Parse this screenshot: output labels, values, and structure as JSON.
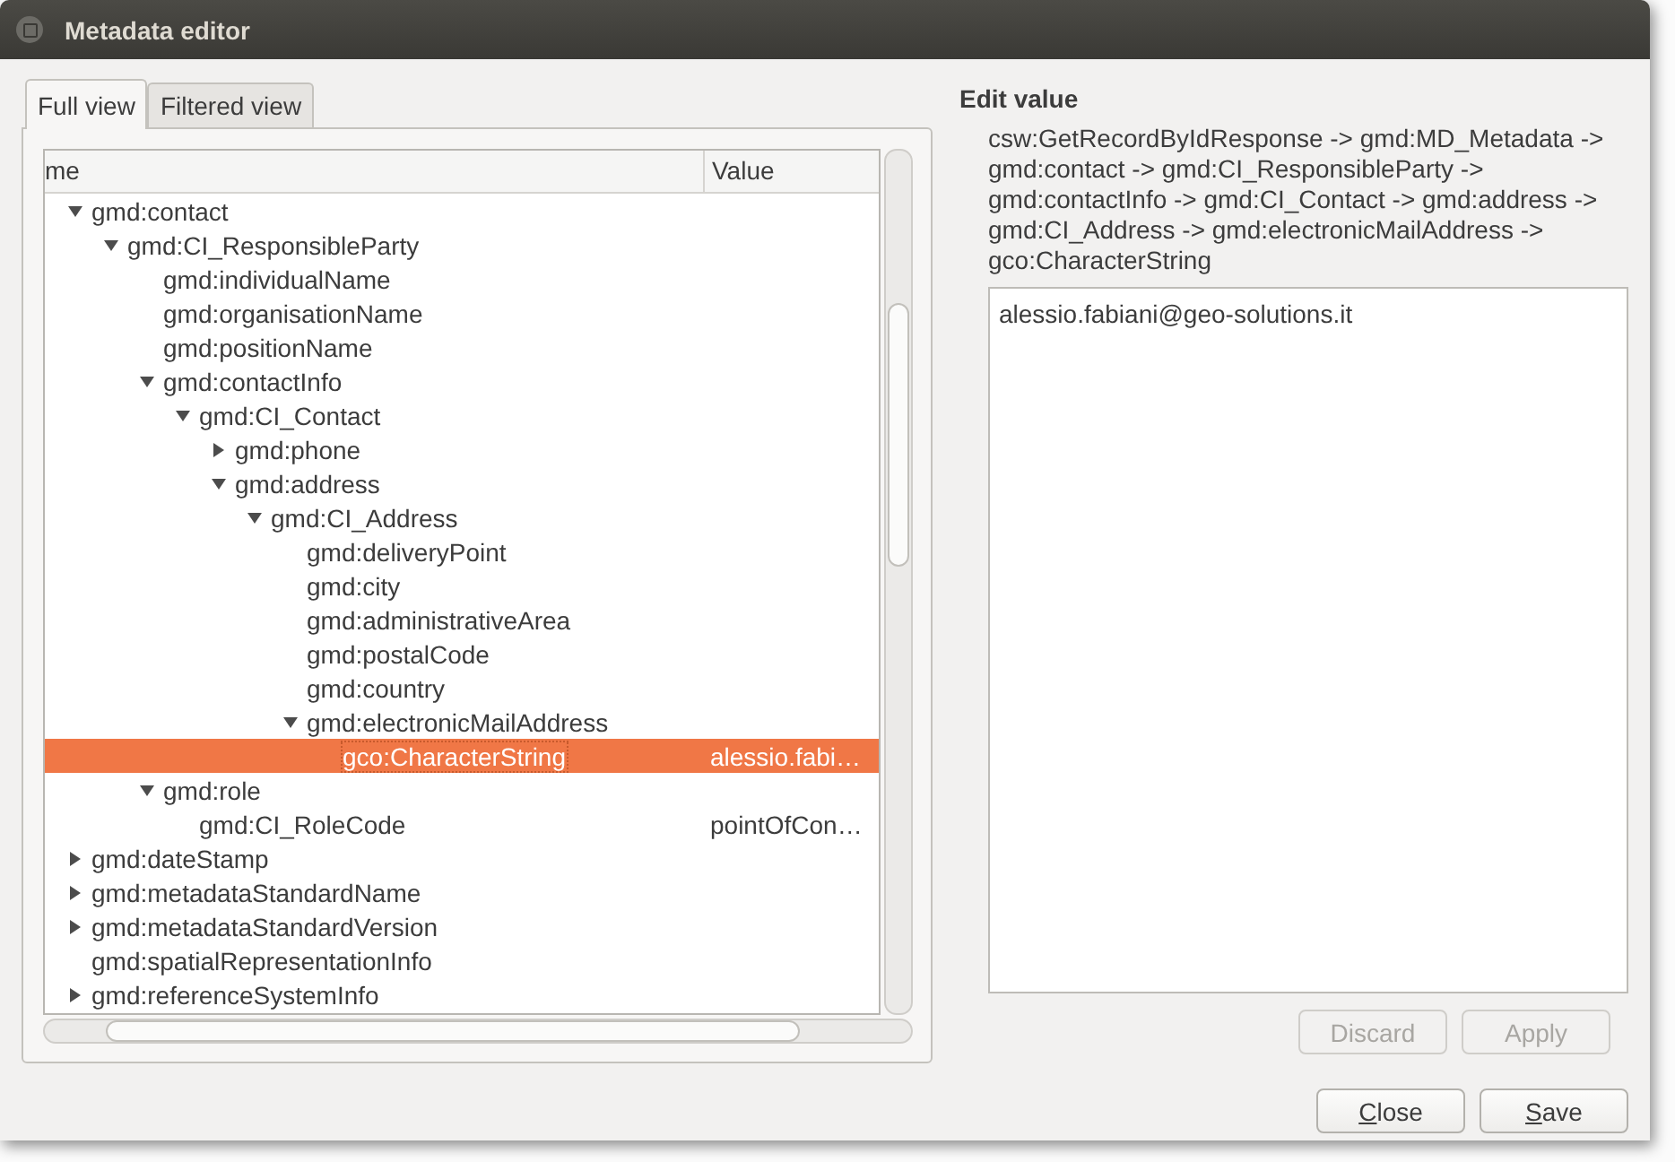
{
  "window": {
    "title": "Metadata editor"
  },
  "tabs": [
    {
      "label": "Full view",
      "selected": true
    },
    {
      "label": "Filtered view",
      "selected": false
    }
  ],
  "tree": {
    "columns": [
      "me",
      "Value"
    ],
    "rows": [
      {
        "name": "gmd:contact",
        "expanded": true,
        "selected": false,
        "children": [
          {
            "name": "gmd:CI_ResponsibleParty",
            "expanded": true,
            "selected": false,
            "children": [
              {
                "name": "gmd:individualName",
                "selected": false
              },
              {
                "name": "gmd:organisationName",
                "selected": false
              },
              {
                "name": "gmd:positionName",
                "selected": false
              },
              {
                "name": "gmd:contactInfo",
                "expanded": true,
                "selected": false,
                "children": [
                  {
                    "name": "gmd:CI_Contact",
                    "expanded": true,
                    "selected": false,
                    "children": [
                      {
                        "name": "gmd:phone",
                        "expanded": false,
                        "selected": false
                      },
                      {
                        "name": "gmd:address",
                        "expanded": true,
                        "selected": false,
                        "children": [
                          {
                            "name": "gmd:CI_Address",
                            "expanded": true,
                            "selected": false,
                            "children": [
                              {
                                "name": "gmd:deliveryPoint",
                                "selected": false
                              },
                              {
                                "name": "gmd:city",
                                "selected": false
                              },
                              {
                                "name": "gmd:administrativeArea",
                                "selected": false
                              },
                              {
                                "name": "gmd:postalCode",
                                "selected": false
                              },
                              {
                                "name": "gmd:country",
                                "selected": false
                              },
                              {
                                "name": "gmd:electronicMailAddress",
                                "expanded": true,
                                "selected": false,
                                "children": [
                                  {
                                    "name": "gco:CharacterString",
                                    "value": "alessio.fabi…",
                                    "selected": true
                                  }
                                ]
                              }
                            ]
                          }
                        ]
                      }
                    ]
                  }
                ]
              },
              {
                "name": "gmd:role",
                "expanded": true,
                "selected": false,
                "children": [
                  {
                    "name": "gmd:CI_RoleCode",
                    "value": "pointOfCon…",
                    "selected": false
                  }
                ]
              }
            ]
          }
        ]
      },
      {
        "name": "gmd:dateStamp",
        "expanded": false,
        "selected": false
      },
      {
        "name": "gmd:metadataStandardName",
        "expanded": false,
        "selected": false
      },
      {
        "name": "gmd:metadataStandardVersion",
        "expanded": false,
        "selected": false
      },
      {
        "name": "gmd:spatialRepresentationInfo",
        "selected": false
      },
      {
        "name": "gmd:referenceSystemInfo",
        "expanded": false,
        "selected": false
      }
    ]
  },
  "edit_panel": {
    "heading": "Edit value",
    "path": "csw:GetRecordByIdResponse -> gmd:MD_Metadata -> gmd:contact -> gmd:CI_ResponsibleParty -> gmd:contactInfo -> gmd:CI_Contact -> gmd:address -> gmd:CI_Address -> gmd:electronicMailAddress -> gco:CharacterString",
    "value": "alessio.fabiani@geo-solutions.it",
    "buttons": [
      {
        "label": "Discard",
        "disabled": true
      },
      {
        "label": "Apply",
        "disabled": true
      }
    ]
  },
  "dialog_buttons": [
    {
      "label": "Close",
      "underline_first": true
    },
    {
      "label": "Save",
      "underline_first": true
    }
  ]
}
